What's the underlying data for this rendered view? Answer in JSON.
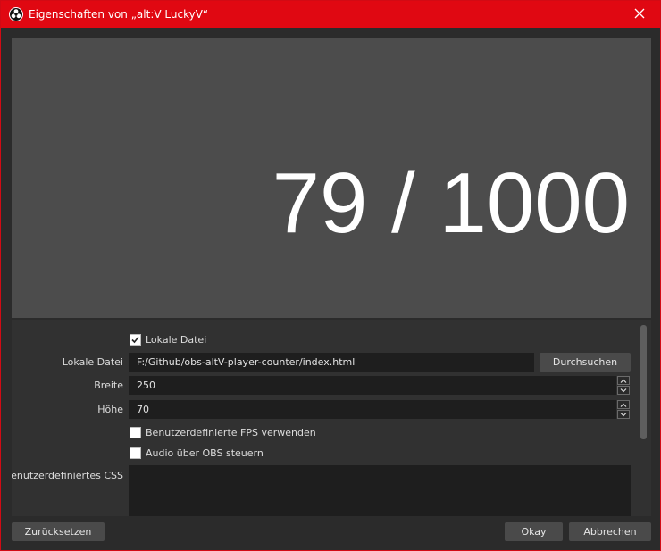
{
  "window": {
    "title": "Eigenschaften von „alt:V LuckyV“",
    "app_icon": "obs-logo-icon",
    "close_icon": "close-icon",
    "accent": "#e00812"
  },
  "preview": {
    "text": "79 / 1000",
    "background": "#4c4c4c"
  },
  "properties": {
    "local_file_checkbox": {
      "label": "Lokale Datei",
      "checked": true
    },
    "local_file": {
      "label": "Lokale Datei",
      "value": "F:/Github/obs-altV-player-counter/index.html",
      "browse_label": "Durchsuchen"
    },
    "width": {
      "label": "Breite",
      "value": "250"
    },
    "height": {
      "label": "Höhe",
      "value": "70"
    },
    "custom_fps": {
      "label": "Benutzerdefinierte FPS verwenden",
      "checked": false
    },
    "audio_obs": {
      "label": "Audio über OBS steuern",
      "checked": false
    },
    "custom_css": {
      "label": "Benutzerdefiniertes CSS",
      "value": ""
    }
  },
  "footer": {
    "reset_label": "Zurücksetzen",
    "ok_label": "Okay",
    "cancel_label": "Abbrechen"
  }
}
